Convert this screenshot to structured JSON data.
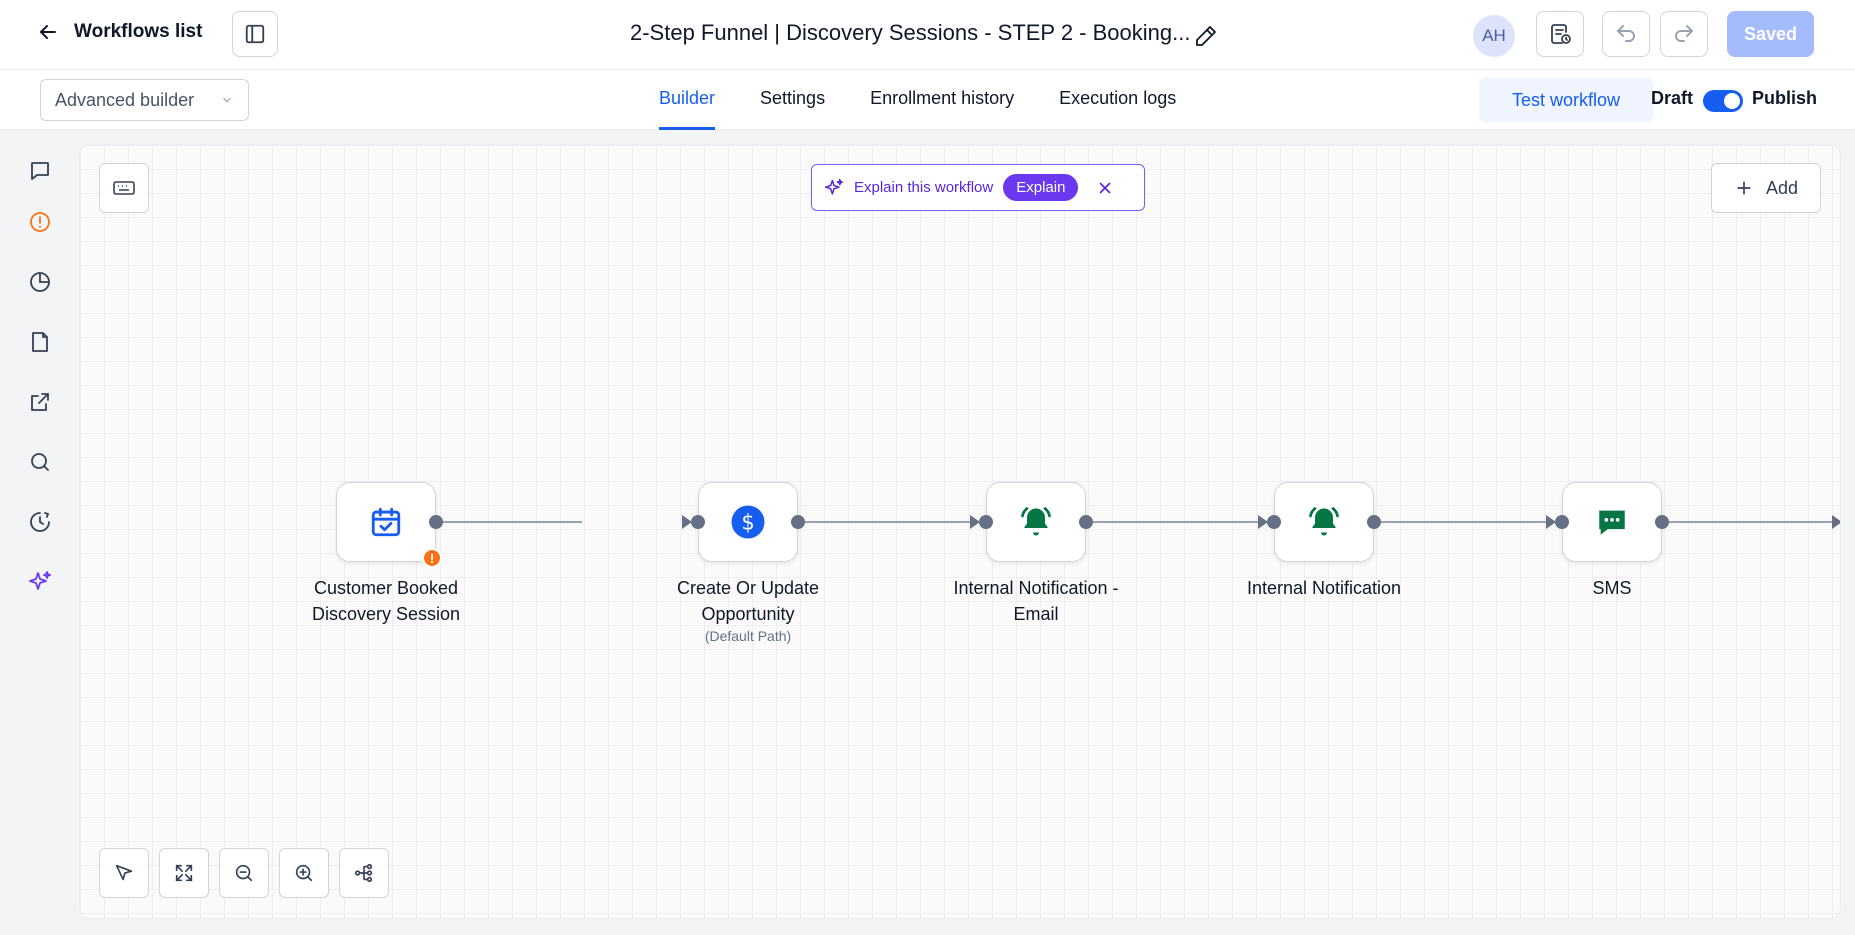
{
  "header": {
    "back_label": "Workflows list",
    "title": "2-Step Funnel | Discovery Sessions - STEP 2 - Booking...",
    "avatar_initials": "AH",
    "saved_label": "Saved"
  },
  "subbar": {
    "mode_value": "Advanced builder",
    "tabs": [
      {
        "label": "Builder",
        "active": true
      },
      {
        "label": "Settings",
        "active": false
      },
      {
        "label": "Enrollment history",
        "active": false
      },
      {
        "label": "Execution logs",
        "active": false
      }
    ],
    "test_label": "Test workflow",
    "draft_label": "Draft",
    "publish_label": "Publish",
    "publish_on": true
  },
  "rail": {
    "items": [
      "chat-icon",
      "alert-circle-icon",
      "pie-chart-icon",
      "document-icon",
      "external-link-icon",
      "search-icon",
      "history-icon",
      "sparkle-icon"
    ]
  },
  "canvas": {
    "explain_text": "Explain this workflow",
    "explain_button": "Explain",
    "add_label": "Add",
    "nodes": [
      {
        "label_line1": "Customer Booked",
        "label_line2": "Discovery Session",
        "sub": "",
        "icon": "calendar-check-icon",
        "icon_color": "#155eef",
        "warning": "!"
      },
      {
        "label_line1": "Create Or Update",
        "label_line2": "Opportunity",
        "sub": "(Default Path)",
        "icon": "dollar-icon",
        "icon_color": "#155eef"
      },
      {
        "label_line1": "Internal Notification -",
        "label_line2": "Email",
        "sub": "",
        "icon": "bell-icon",
        "icon_color": "#067647"
      },
      {
        "label_line1": "Internal Notification",
        "label_line2": "",
        "sub": "",
        "icon": "bell-icon",
        "icon_color": "#067647"
      },
      {
        "label_line1": "SMS",
        "label_line2": "",
        "sub": "",
        "icon": "message-icon",
        "icon_color": "#067647"
      }
    ]
  },
  "colors": {
    "primary": "#155eef",
    "accent_purple": "#6938ef",
    "warning": "#f97316",
    "saved_bg": "#a4bcfd"
  }
}
